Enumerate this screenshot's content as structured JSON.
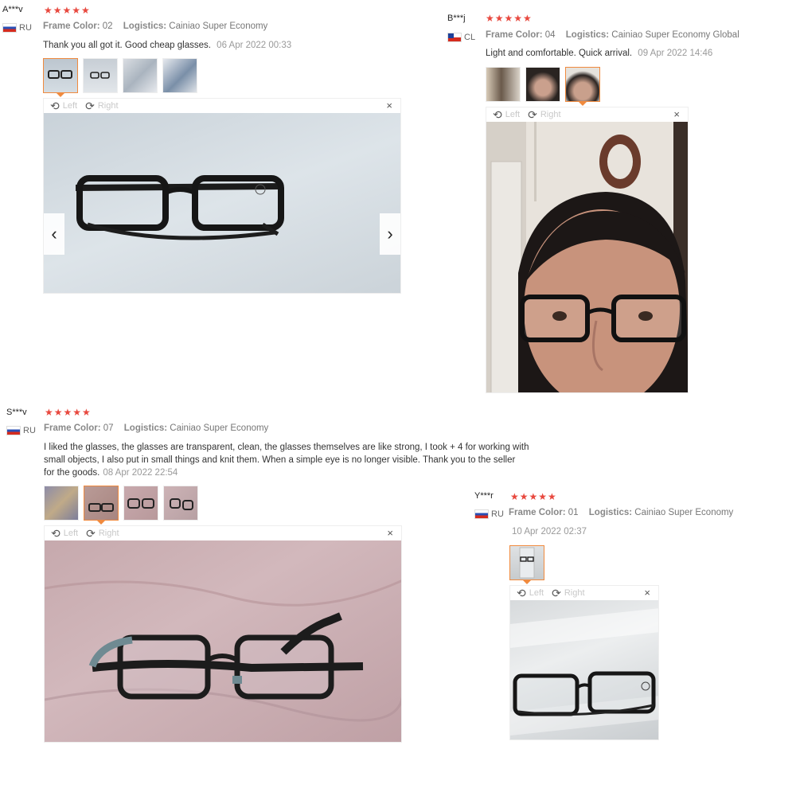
{
  "labels": {
    "frame_color": "Frame Color:",
    "logistics": "Logistics:",
    "left": "Left",
    "right": "Right",
    "close": "×",
    "prev": "‹",
    "next": "›"
  },
  "colors": {
    "star": "#e8483e",
    "active_border": "#f08a3e"
  },
  "icons": {
    "rotate_left": "rotate-left-icon",
    "rotate_right": "rotate-right-icon",
    "close": "close-icon",
    "star": "star-icon"
  },
  "reviews": [
    {
      "name": "A***v",
      "country": "RU",
      "stars": "★★★★★",
      "rating": 5,
      "frame_color": "02",
      "logistics": "Cainiao Super Economy",
      "text": "Thank you all got it. Good cheap glasses.",
      "date": "06 Apr 2022 00:33",
      "photo_count": 4,
      "active_photo": 1
    },
    {
      "name": "B***j",
      "country": "CL",
      "stars": "★★★★★",
      "rating": 5,
      "frame_color": "04",
      "logistics": "Cainiao Super Economy Global",
      "text": "Light and comfortable. Quick arrival.",
      "date": "09 Apr 2022 14:46",
      "photo_count": 3,
      "active_photo": 3
    },
    {
      "name": "S***v",
      "country": "RU",
      "stars": "★★★★★",
      "rating": 5,
      "frame_color": "07",
      "logistics": "Cainiao Super Economy",
      "text_lines": [
        "I liked the glasses, the glasses are transparent, clean, the glasses themselves are like strong, I took + 4 for working with",
        "small objects, I also put in small things and knit them. When a simple eye is no longer visible. Thank you to the seller",
        "for the goods."
      ],
      "date": "08 Apr 2022 22:54",
      "photo_count": 4,
      "active_photo": 2
    },
    {
      "name": "Y***r",
      "country": "RU",
      "stars": "★★★★★",
      "rating": 5,
      "frame_color": "01",
      "logistics": "Cainiao Super Economy",
      "date": "10 Apr 2022 02:37",
      "photo_count": 1,
      "active_photo": 1
    }
  ]
}
